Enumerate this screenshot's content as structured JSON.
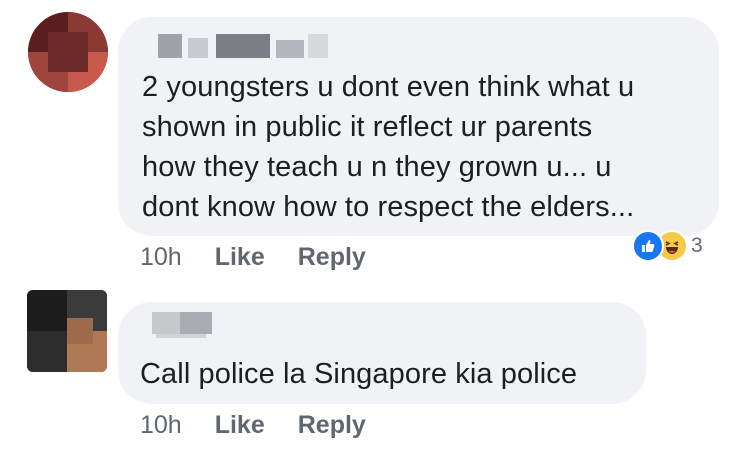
{
  "comments": [
    {
      "text_lines": [
        "2 youngsters u dont even think what u",
        "shown in public it reflect ur parents",
        "how they teach u n they grown u... u",
        "dont know how to respect the elders..."
      ],
      "timestamp": "10h",
      "like_label": "Like",
      "reply_label": "Reply",
      "reaction_count": "3",
      "reaction_icons": [
        "like-icon",
        "haha-icon"
      ]
    },
    {
      "text_lines": [
        "Call police la Singapore kia police"
      ],
      "timestamp": "10h",
      "like_label": "Like",
      "reply_label": "Reply"
    }
  ],
  "colors": {
    "bubble": "#f1f2f6",
    "text": "#1c1e21",
    "meta": "#606770",
    "like_blue": "#1877f2",
    "haha_yellow": "#f7c948"
  }
}
